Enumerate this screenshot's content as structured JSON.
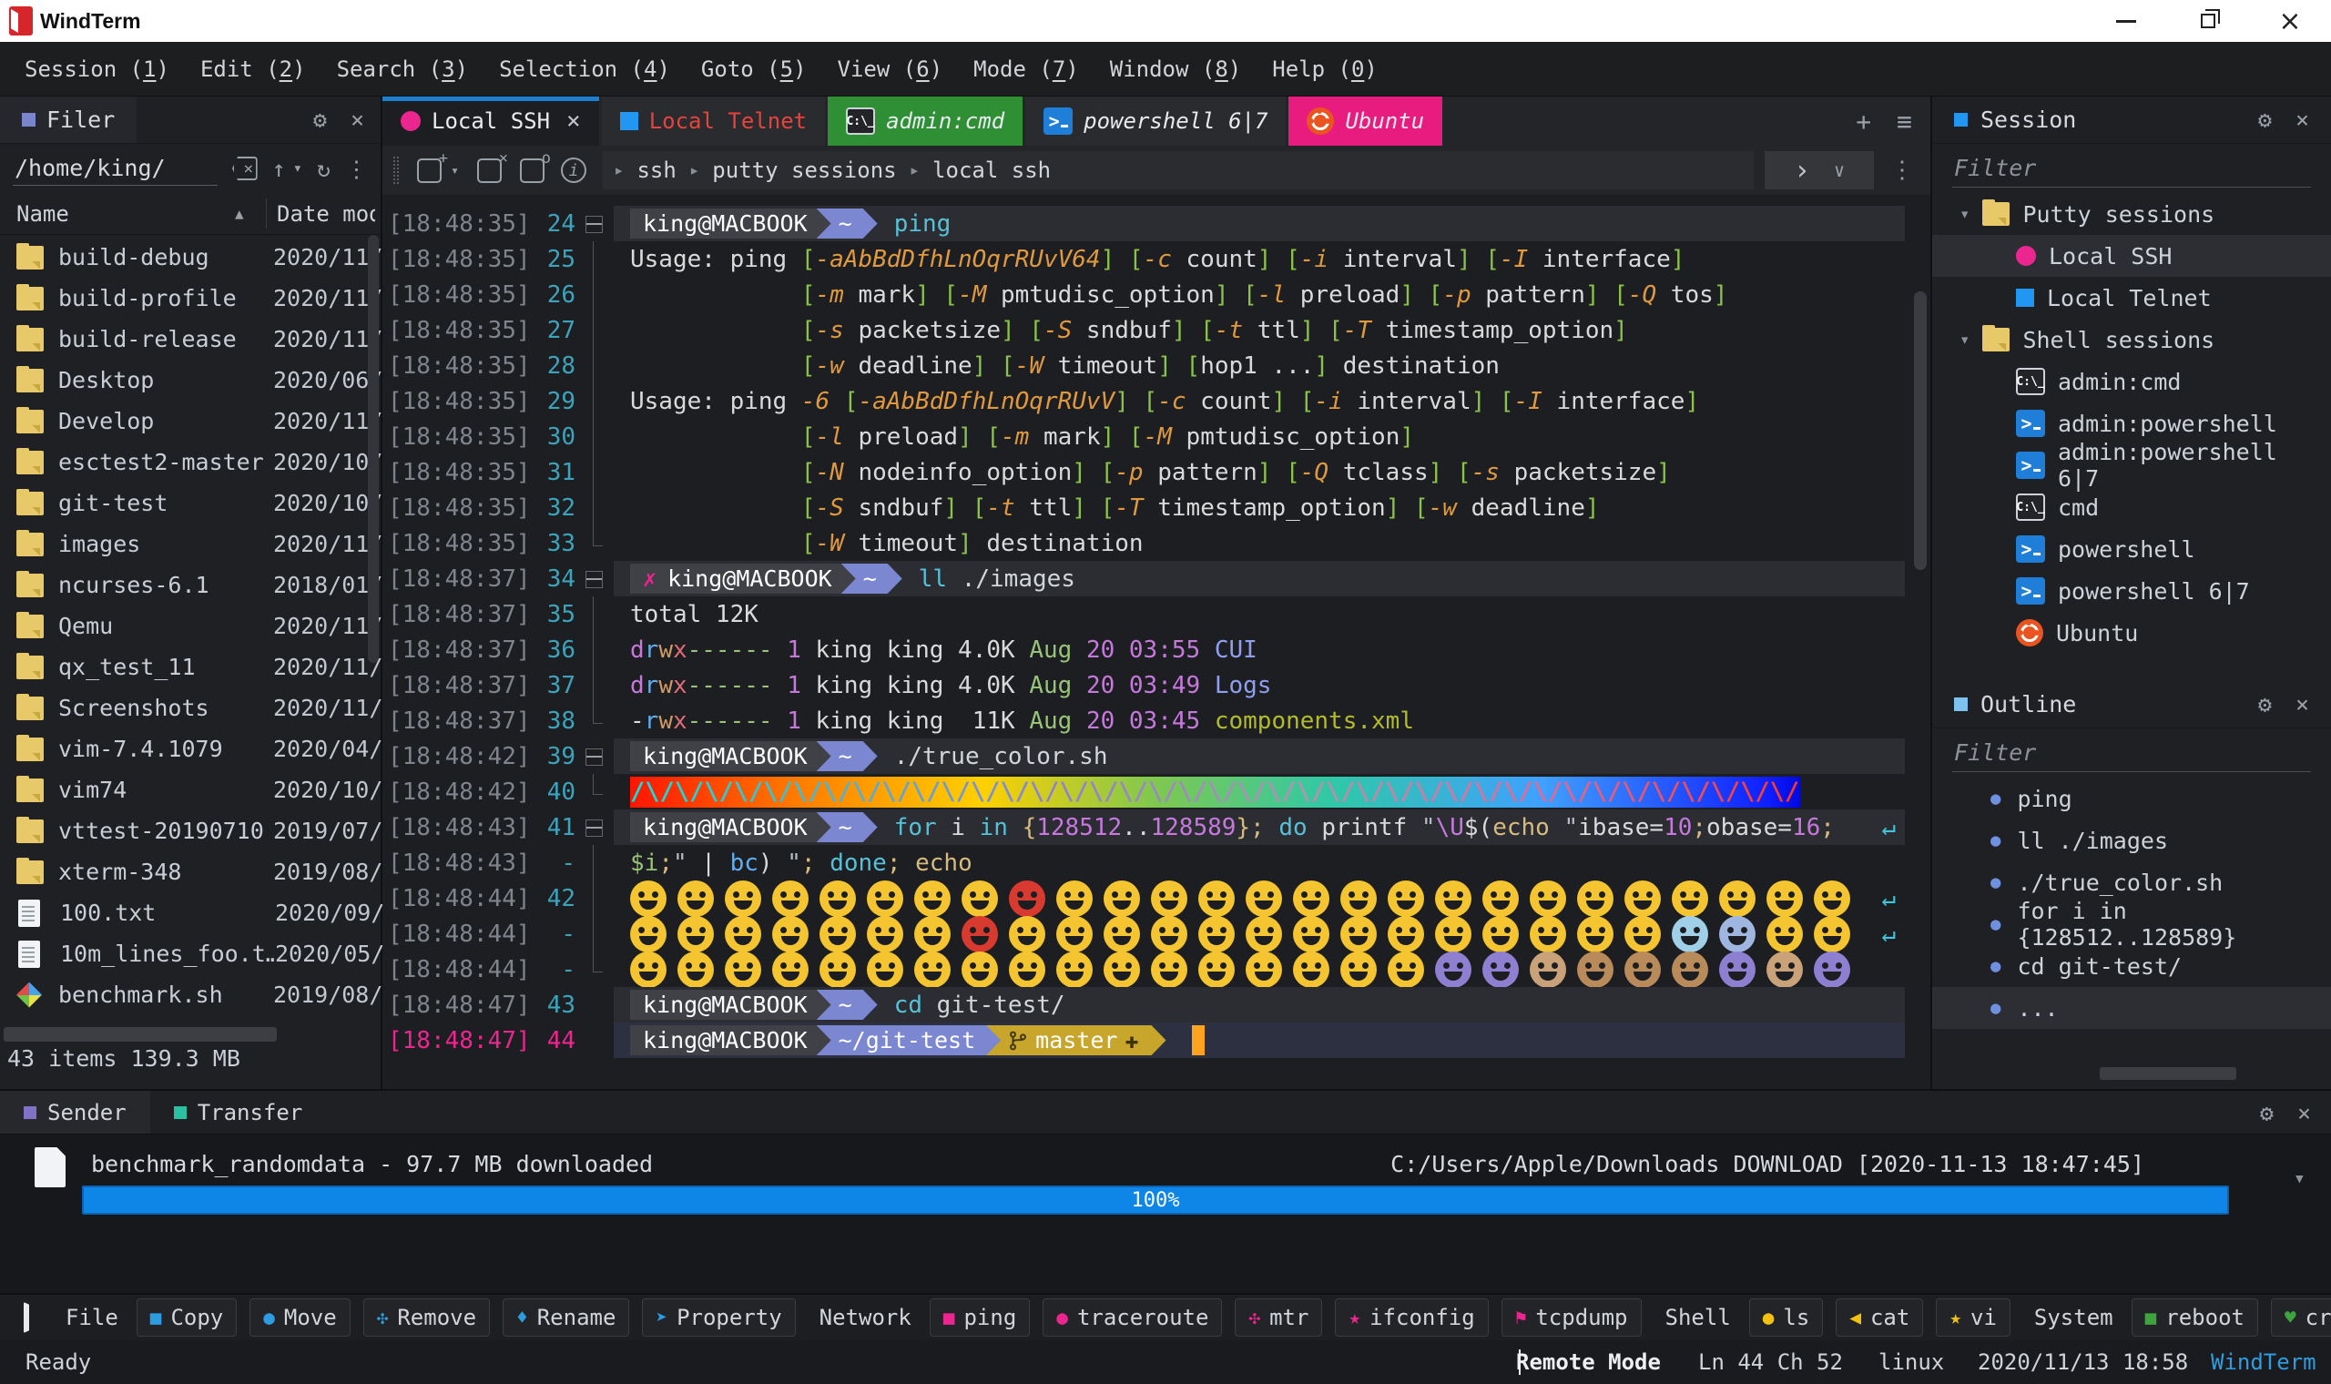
{
  "colors": {
    "accent_blue": "#1d7fd0",
    "pink": "#ec268f",
    "tab_green": "#2f8f35",
    "tab_pink": "#e81c7f",
    "progress_blue": "#0e86e8",
    "ubuntu_orange": "#e95420",
    "ps_blue": "#1f7fd8",
    "folder_yellow": "#e8c96a",
    "filer_icon": "#7986cb",
    "session_icon": "#2196f3",
    "outline_icon": "#7ec3f0",
    "sender_icon": "#8172c8",
    "transfer_icon": "#2bbfa4",
    "brand_text": "#2f9ce0",
    "logo_red": "#d6252b"
  },
  "icons": {
    "gear": "⚙",
    "close": "×",
    "plus": "+",
    "menu": "≡",
    "dots": "⋮",
    "up": "↑",
    "caret": "▾",
    "refresh": "↻",
    "sort": "▲",
    "chevron": "▸",
    "run": "›",
    "run_caret": "∨",
    "wrap": "↵",
    "cross": "✗",
    "branch_plus": "✚",
    "bullet": "●",
    "info": "i",
    "cmd_text": "C:\\_",
    "ps_text": ">",
    "backspace_x": "×",
    "tab_new": "+",
    "tab_close": "×",
    "tab_o": "o"
  },
  "icon_glyphs": {
    "square": "■",
    "circle": "●",
    "pinwheel": "✣",
    "drop": "♦",
    "arrow": "➤",
    "star": "★",
    "flag": "⚑",
    "tri": "◀",
    "heart": "♥"
  },
  "titlebar": {
    "title": "WindTerm"
  },
  "menubar": {
    "items": [
      {
        "text": "Session",
        "accel": "1"
      },
      {
        "text": "Edit",
        "accel": "2"
      },
      {
        "text": "Search",
        "accel": "3"
      },
      {
        "text": "Selection",
        "accel": "4"
      },
      {
        "text": "Goto",
        "accel": "5"
      },
      {
        "text": "View",
        "accel": "6"
      },
      {
        "text": "Mode",
        "accel": "7"
      },
      {
        "text": "Window",
        "accel": "8"
      },
      {
        "text": "Help",
        "accel": "0"
      }
    ]
  },
  "filer": {
    "tab_label": "Filer",
    "path": "/home/king/",
    "columns": {
      "name": "Name",
      "date": "Date mod"
    },
    "status": "43 items 139.3 MB",
    "files": [
      {
        "name": "build-debug",
        "date": "2020/11/",
        "type": "folder"
      },
      {
        "name": "build-profile",
        "date": "2020/11/",
        "type": "folder"
      },
      {
        "name": "build-release",
        "date": "2020/11/",
        "type": "folder"
      },
      {
        "name": "Desktop",
        "date": "2020/06/",
        "type": "folder"
      },
      {
        "name": "Develop",
        "date": "2020/11/",
        "type": "folder"
      },
      {
        "name": "esctest2-master",
        "date": "2020/10/",
        "type": "folder"
      },
      {
        "name": "git-test",
        "date": "2020/10/",
        "type": "folder"
      },
      {
        "name": "images",
        "date": "2020/11/",
        "type": "folder"
      },
      {
        "name": "ncurses-6.1",
        "date": "2018/01/",
        "type": "folder"
      },
      {
        "name": "Qemu",
        "date": "2020/11/",
        "type": "folder"
      },
      {
        "name": "qx_test_11",
        "date": "2020/11/",
        "type": "folder"
      },
      {
        "name": "Screenshots",
        "date": "2020/11/",
        "type": "folder"
      },
      {
        "name": "vim-7.4.1079",
        "date": "2020/04/",
        "type": "folder"
      },
      {
        "name": "vim74",
        "date": "2020/10/",
        "type": "folder"
      },
      {
        "name": "vttest-20190710",
        "date": "2019/07/",
        "type": "folder"
      },
      {
        "name": "xterm-348",
        "date": "2019/08/",
        "type": "folder"
      },
      {
        "name": "100.txt",
        "date": "2020/09/",
        "type": "file"
      },
      {
        "name": "10m_lines_foo.t…",
        "date": "2020/05/",
        "type": "file"
      },
      {
        "name": "benchmark.sh",
        "date": "2019/08/",
        "type": "script"
      }
    ]
  },
  "terminal": {
    "tabs": [
      {
        "label": "Local SSH",
        "icon": "ssh",
        "active": true,
        "closable": true
      },
      {
        "label": "Local Telnet",
        "icon": "telnet",
        "red": true
      },
      {
        "label": "admin:cmd",
        "icon": "cmd",
        "style": "green",
        "italic": true
      },
      {
        "label": "powershell 6|7",
        "icon": "ps",
        "italic": true
      },
      {
        "label": "Ubuntu",
        "icon": "ubuntu",
        "style": "pink",
        "italic": true
      }
    ],
    "breadcrumb": [
      "ssh",
      "putty sessions",
      "local ssh"
    ],
    "lines": [
      {
        "ts": "[18:48:35]",
        "ln": "24",
        "fold": "open",
        "kind": "prompt",
        "host": "king@MACBOOK",
        "path": "~",
        "cmd": [
          [
            "cmd",
            "ping"
          ]
        ]
      },
      {
        "ts": "[18:48:35]",
        "ln": "25",
        "fold": "mid",
        "kind": "usage",
        "text": "Usage: ping [-aAbBdDfhLnOqrRUvV64] [-c count] [-i interval] [-I interface]"
      },
      {
        "ts": "[18:48:35]",
        "ln": "26",
        "fold": "mid",
        "kind": "usage",
        "text": "            [-m mark] [-M pmtudisc_option] [-l preload] [-p pattern] [-Q tos]"
      },
      {
        "ts": "[18:48:35]",
        "ln": "27",
        "fold": "mid",
        "kind": "usage",
        "text": "            [-s packetsize] [-S sndbuf] [-t ttl] [-T timestamp_option]"
      },
      {
        "ts": "[18:48:35]",
        "ln": "28",
        "fold": "mid",
        "kind": "usage",
        "text": "            [-w deadline] [-W timeout] [hop1 ...] destination"
      },
      {
        "ts": "[18:48:35]",
        "ln": "29",
        "fold": "mid",
        "kind": "usage",
        "text": "Usage: ping -6 [-aAbBdDfhLnOqrRUvV] [-c count] [-i interval] [-I interface]"
      },
      {
        "ts": "[18:48:35]",
        "ln": "30",
        "fold": "mid",
        "kind": "usage",
        "text": "            [-l preload] [-m mark] [-M pmtudisc_option]"
      },
      {
        "ts": "[18:48:35]",
        "ln": "31",
        "fold": "mid",
        "kind": "usage",
        "text": "            [-N nodeinfo_option] [-p pattern] [-Q tclass] [-s packetsize]"
      },
      {
        "ts": "[18:48:35]",
        "ln": "32",
        "fold": "mid",
        "kind": "usage",
        "text": "            [-S sndbuf] [-t ttl] [-T timestamp_option] [-w deadline]"
      },
      {
        "ts": "[18:48:35]",
        "ln": "33",
        "fold": "end",
        "kind": "usage",
        "text": "            [-W timeout] destination"
      },
      {
        "ts": "[18:48:37]",
        "ln": "34",
        "fold": "open",
        "kind": "prompt",
        "err": true,
        "host": "king@MACBOOK",
        "path": "~",
        "cmd": [
          [
            "cmd",
            "ll"
          ],
          [
            "path",
            " ./images"
          ]
        ]
      },
      {
        "ts": "[18:48:37]",
        "ln": "35",
        "fold": "mid",
        "kind": "segs",
        "segs": [
          [
            "def",
            "total 12K"
          ]
        ]
      },
      {
        "ts": "[18:48:37]",
        "ln": "36",
        "fold": "mid",
        "kind": "segs",
        "segs": [
          [
            "pur",
            "d"
          ],
          [
            "blu",
            "r"
          ],
          [
            "org",
            "w"
          ],
          [
            "red",
            "x"
          ],
          [
            "grn",
            "------"
          ],
          [
            "def",
            " "
          ],
          [
            "pur",
            "1"
          ],
          [
            "def",
            " king king 4.0K "
          ],
          [
            "grn",
            "Aug"
          ],
          [
            "def",
            " "
          ],
          [
            "pur",
            "20 03:55"
          ],
          [
            "def",
            " "
          ],
          [
            "dir",
            "CUI"
          ]
        ]
      },
      {
        "ts": "[18:48:37]",
        "ln": "37",
        "fold": "mid",
        "kind": "segs",
        "segs": [
          [
            "pur",
            "d"
          ],
          [
            "blu",
            "r"
          ],
          [
            "org",
            "w"
          ],
          [
            "red",
            "x"
          ],
          [
            "grn",
            "------"
          ],
          [
            "def",
            " "
          ],
          [
            "pur",
            "1"
          ],
          [
            "def",
            " king king 4.0K "
          ],
          [
            "grn",
            "Aug"
          ],
          [
            "def",
            " "
          ],
          [
            "pur",
            "20 03:49"
          ],
          [
            "def",
            " "
          ],
          [
            "dir",
            "Logs"
          ]
        ]
      },
      {
        "ts": "[18:48:37]",
        "ln": "38",
        "fold": "end",
        "kind": "segs",
        "segs": [
          [
            "def",
            "-"
          ],
          [
            "blu",
            "r"
          ],
          [
            "org",
            "w"
          ],
          [
            "red",
            "x"
          ],
          [
            "grn",
            "------"
          ],
          [
            "def",
            " "
          ],
          [
            "pur",
            "1"
          ],
          [
            "def",
            " king king  11K "
          ],
          [
            "grn",
            "Aug"
          ],
          [
            "def",
            " "
          ],
          [
            "pur",
            "20 03:45"
          ],
          [
            "def",
            " "
          ],
          [
            "xml",
            "components.xml"
          ]
        ]
      },
      {
        "ts": "[18:48:42]",
        "ln": "39",
        "fold": "open",
        "kind": "prompt",
        "host": "king@MACBOOK",
        "path": "~",
        "cmd": [
          [
            "path",
            "./true_color.sh"
          ]
        ]
      },
      {
        "ts": "[18:48:42]",
        "ln": "40",
        "fold": "end",
        "kind": "rainbow",
        "pattern": "/\\",
        "repeat": 41
      },
      {
        "ts": "[18:48:43]",
        "ln": "41",
        "fold": "open",
        "kind": "prompt",
        "host": "king@MACBOOK",
        "path": "~",
        "wrap": true,
        "cmd": [
          [
            "cmd",
            "for"
          ],
          [
            "def",
            " i "
          ],
          [
            "cmd",
            "in"
          ],
          [
            "def",
            " "
          ],
          [
            "yel",
            "{"
          ],
          [
            "num",
            "128512"
          ],
          [
            "def",
            ".."
          ],
          [
            "num",
            "128589"
          ],
          [
            "yel",
            "};"
          ],
          [
            "def",
            " "
          ],
          [
            "cmd",
            "do"
          ],
          [
            "def",
            " printf "
          ],
          [
            "str",
            "\""
          ],
          [
            "num",
            "\\U"
          ],
          [
            "def",
            "$("
          ],
          [
            "yel",
            "echo"
          ],
          [
            "def",
            " "
          ],
          [
            "str",
            "\""
          ],
          [
            "def",
            "ibase="
          ],
          [
            "num",
            "10"
          ],
          [
            "yel",
            ";"
          ],
          [
            "def",
            "obase="
          ],
          [
            "num",
            "16"
          ],
          [
            "yel",
            ";"
          ]
        ]
      },
      {
        "ts": "[18:48:43]",
        "ln": "-",
        "fold": "mid",
        "kind": "segs",
        "segs": [
          [
            "grn",
            "$i"
          ],
          [
            "yel",
            ";"
          ],
          [
            "str",
            "\""
          ],
          [
            "def",
            " | "
          ],
          [
            "blu",
            "bc"
          ],
          [
            "def",
            ") "
          ],
          [
            "str",
            "\""
          ],
          [
            "yel",
            ";"
          ],
          [
            "def",
            " "
          ],
          [
            "cmd",
            "done"
          ],
          [
            "yel",
            ";"
          ],
          [
            "def",
            " "
          ],
          [
            "yel",
            "echo"
          ]
        ]
      },
      {
        "ts": "[18:48:44]",
        "ln": "42",
        "fold": "mid",
        "kind": "emoji",
        "wrap": true,
        "chars": "😀😁😂😃😄😅😆😇😈😉😊😋😌😍😎😏😐😑😒😓😔😕😖😗😘😙"
      },
      {
        "ts": "[18:48:44]",
        "ln": "-",
        "fold": "mid",
        "kind": "emoji",
        "wrap": true,
        "chars": "😚😛😜😝😞😟😠😡😢😣😤😥😦😧😨😩😪😫😬😭😮😯😰😱😲😳"
      },
      {
        "ts": "[18:48:44]",
        "ln": "-",
        "fold": "end",
        "kind": "emoji",
        "chars": "😴😵😶😷😸😹😺😻😼😽😾😿🙀🙁🙂🙃🙄🙅🙆🙇🙈🙉🙊🙋🙌🙍"
      },
      {
        "ts": "[18:48:47]",
        "ln": "43",
        "kind": "prompt",
        "host": "king@MACBOOK",
        "path": "~",
        "cmd": [
          [
            "cmd",
            "cd"
          ],
          [
            "path",
            " git-test/"
          ]
        ]
      },
      {
        "ts": "[18:48:47]",
        "ln": "44",
        "kind": "prompt",
        "current": true,
        "host": "king@MACBOOK",
        "path": "~/git-test",
        "git": "master",
        "cursor": true
      }
    ]
  },
  "session_panel": {
    "title": "Session",
    "filter_placeholder": "Filter",
    "tree": [
      {
        "label": "Putty sessions",
        "group": true
      },
      {
        "label": "Local SSH",
        "icon": "ssh",
        "selected": true
      },
      {
        "label": "Local Telnet",
        "icon": "telnet"
      },
      {
        "label": "Shell sessions",
        "group": true
      },
      {
        "label": "admin:cmd",
        "icon": "cmd"
      },
      {
        "label": "admin:powershell",
        "icon": "ps"
      },
      {
        "label": "admin:powershell 6|7",
        "icon": "ps"
      },
      {
        "label": "cmd",
        "icon": "cmd"
      },
      {
        "label": "powershell",
        "icon": "ps"
      },
      {
        "label": "powershell 6|7",
        "icon": "ps"
      },
      {
        "label": "Ubuntu",
        "icon": "ubuntu"
      }
    ]
  },
  "outline_panel": {
    "title": "Outline",
    "filter_placeholder": "Filter",
    "items": [
      "ping",
      "ll ./images",
      "./true_color.sh",
      "for i in {128512..128589}",
      "cd git-test/",
      "..."
    ],
    "selected_index": 5
  },
  "transfer_panel": {
    "tabs": [
      {
        "label": "Sender",
        "active": true
      },
      {
        "label": "Transfer"
      }
    ],
    "file_label": "benchmark_randomdata - 97.7 MB downloaded",
    "destination": "C:/Users/Apple/Downloads DOWNLOAD [2020-11-13 18:47:45]",
    "progress_label": "100%",
    "progress_value": 100
  },
  "bottom_toolbar": {
    "groups": [
      {
        "label": "File",
        "color": "#2d9ce0",
        "buttons": [
          {
            "label": "Copy",
            "icon": "square"
          },
          {
            "label": "Move",
            "icon": "circle"
          },
          {
            "label": "Remove",
            "icon": "pinwheel"
          },
          {
            "label": "Rename",
            "icon": "drop"
          },
          {
            "label": "Property",
            "icon": "arrow"
          }
        ]
      },
      {
        "label": "Network",
        "color": "#ec268f",
        "buttons": [
          {
            "label": "ping",
            "icon": "square"
          },
          {
            "label": "traceroute",
            "icon": "circle"
          },
          {
            "label": "mtr",
            "icon": "pinwheel"
          },
          {
            "label": "ifconfig",
            "icon": "star"
          },
          {
            "label": "tcpdump",
            "icon": "flag"
          }
        ]
      },
      {
        "label": "Shell",
        "color": "#f3c211",
        "buttons": [
          {
            "label": "ls",
            "icon": "circle"
          },
          {
            "label": "cat",
            "icon": "tri"
          },
          {
            "label": "vi",
            "icon": "star"
          }
        ]
      },
      {
        "label": "System",
        "color": "#3fa33f",
        "buttons": [
          {
            "label": "reboot",
            "icon": "square"
          },
          {
            "label": "crontab",
            "icon": "heart"
          }
        ]
      }
    ]
  },
  "statusbar": {
    "ready": "Ready",
    "mode": "Remote Mode",
    "position": "Ln 44 Ch 52",
    "os": "linux",
    "datetime": "2020/11/13 18:58",
    "brand": "WindTerm"
  },
  "emoji_colors": {
    "😈": "#d93a2f",
    "😡": "#d93a2f",
    "😰": "#9fd0e8",
    "😱": "#9fb6e0",
    "🙅": "#8f7fd0",
    "🙆": "#8f7fd0",
    "🙇": "#caa27a",
    "🙈": "#b98a5a",
    "🙉": "#b98a5a",
    "🙊": "#b98a5a",
    "🙋": "#8f7fd0",
    "🙌": "#caa27a",
    "🙍": "#8f7fd0"
  }
}
